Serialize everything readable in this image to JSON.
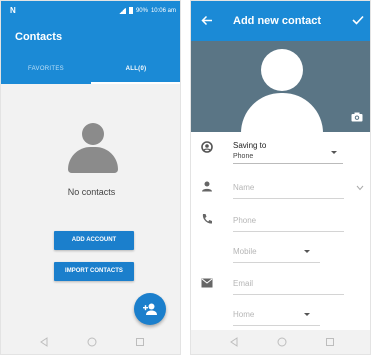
{
  "left": {
    "status": {
      "logo": "N",
      "battery": "90%",
      "time": "10:06 am"
    },
    "title": "Contacts",
    "tabs": [
      {
        "label": "FAVORITES",
        "selected": false
      },
      {
        "label": "ALL(0)",
        "selected": true
      }
    ],
    "empty_state": "No contacts",
    "buttons": {
      "add_account": "ADD ACCOUNT",
      "import_contacts": "IMPORT CONTACTS"
    },
    "fab_icon": "add-contact-icon"
  },
  "right": {
    "title": "Add new contact",
    "saving_to": {
      "label": "Saving to",
      "value": "Phone"
    },
    "fields": {
      "name_placeholder": "Name",
      "phone_placeholder": "Phone",
      "phone_type": "Mobile",
      "email_placeholder": "Email",
      "email_type": "Home"
    }
  },
  "colors": {
    "primary": "#1b8ad6",
    "button": "#1b7fcc",
    "photo_bg": "#5a7585"
  }
}
